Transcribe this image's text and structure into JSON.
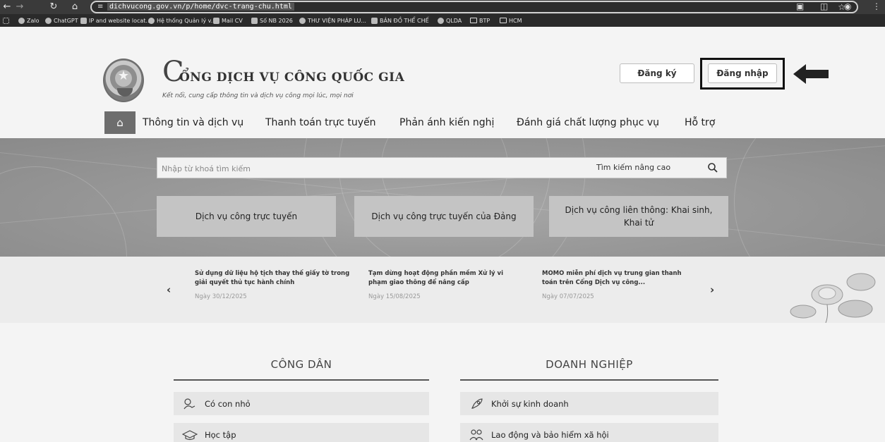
{
  "browser": {
    "url": "dichvucong.gov.vn/p/home/dvc-trang-chu.html",
    "bookmarks": [
      "Zalo",
      "ChatGPT",
      "IP and website locat...",
      "Hệ thống Quản lý v...",
      "Mail CV",
      "Số NB 2026",
      "THƯ VIỆN PHÁP LU...",
      "BẢN ĐỒ THỂ CHẾ",
      "QLDA",
      "BTP",
      "HCM"
    ]
  },
  "header": {
    "logo_letter": "C",
    "title": "ỔNG DỊCH VỤ CÔNG QUỐC GIA",
    "subtitle": "Kết nối, cung cấp thông tin và dịch vụ công mọi lúc, mọi nơi",
    "register_label": "Đăng ký",
    "login_label": "Đăng nhập"
  },
  "menu": {
    "items": [
      "Thông tin và dịch vụ",
      "Thanh toán trực tuyến",
      "Phản ánh kiến nghị",
      "Đánh giá chất lượng phục vụ",
      "Hỗ trợ"
    ]
  },
  "search": {
    "placeholder": "Nhập từ khoá tìm kiếm",
    "advanced_label": "Tìm kiếm nâng cao"
  },
  "services": [
    "Dịch vụ công trực tuyến",
    "Dịch vụ công trực tuyến của Đảng",
    "Dịch vụ công liên thông: Khai sinh, Khai tử"
  ],
  "news": [
    {
      "title": "Sử dụng dữ liệu hộ tịch thay thế giấy tờ trong giải quyết thủ tục hành chính",
      "date": "Ngày 30/12/2025"
    },
    {
      "title": "Tạm dừng hoạt động phần mềm Xử lý vi phạm giao thông để nâng cấp",
      "date": "Ngày 15/08/2025"
    },
    {
      "title": "MOMO miễn phí dịch vụ trung gian thanh toán trên Cổng Dịch vụ công...",
      "date": "Ngày 07/07/2025"
    }
  ],
  "citizen": {
    "heading": "CÔNG DÂN",
    "items": [
      "Có con nhỏ",
      "Học tập"
    ]
  },
  "business": {
    "heading": "DOANH NGHIỆP",
    "items": [
      "Khởi sự kinh doanh",
      "Lao động và bảo hiểm xã hội"
    ]
  },
  "colors": {
    "accent": "#6d6d6d",
    "chrome_dark": "#3a3a3a"
  }
}
